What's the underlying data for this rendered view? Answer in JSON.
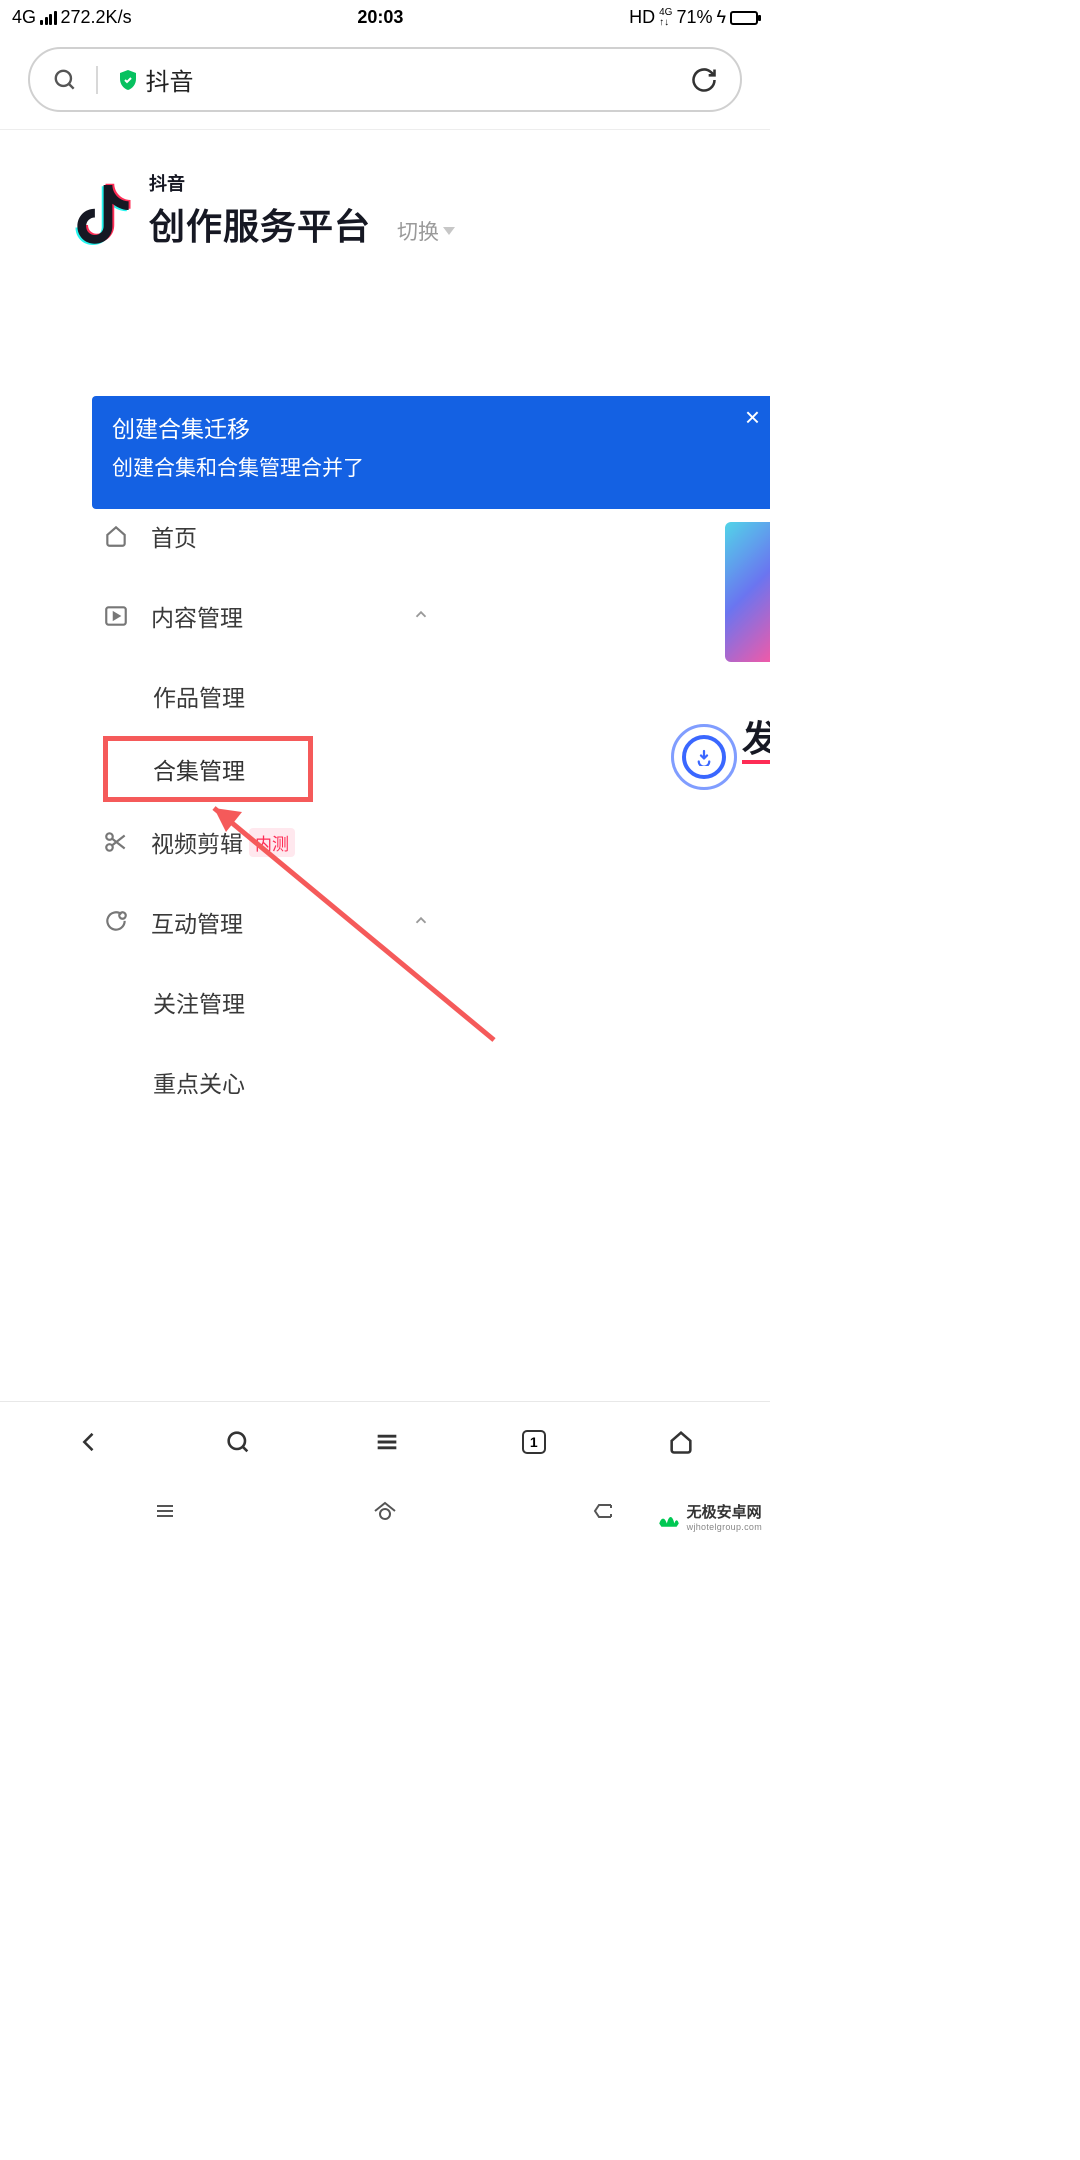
{
  "status": {
    "net": "4G",
    "speed": "272.2K/s",
    "time": "20:03",
    "hd": "HD",
    "nettype": "4G",
    "battery": "71%"
  },
  "search": {
    "text": "抖音"
  },
  "logo": {
    "small": "抖音",
    "large": "创作服务平台",
    "switch": "切换"
  },
  "banner": {
    "title": "创建合集迁移",
    "sub": "创建合集和合集管理合并了"
  },
  "menu": {
    "home": "首页",
    "content": "内容管理",
    "works": "作品管理",
    "collection": "合集管理",
    "video": "视频剪辑",
    "badge": "内测",
    "interact": "互动管理",
    "follow": "关注管理",
    "focus": "重点关心"
  },
  "side_label": "发",
  "tabs": {
    "count": "1"
  },
  "watermark": {
    "cn": "无极安卓网",
    "en": "wjhotelgroup.com"
  }
}
